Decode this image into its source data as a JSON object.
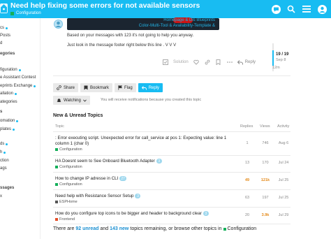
{
  "header": {
    "title": "Need help fixing some errors for not available sensors",
    "category": "Configuration",
    "category_color": "#14af5a",
    "accent": "#18bcf2",
    "icons": [
      "chat-icon",
      "search-icon",
      "hamburger-icon",
      "user-avatar-icon"
    ]
  },
  "sidebar": {
    "items": [
      {
        "label": "cs",
        "dot": true
      },
      {
        "label": "Posts",
        "dot": false
      },
      {
        "label": "d",
        "dot": false
      },
      {
        "label": "egories",
        "dot": false,
        "head": true
      },
      {
        "label": "figuration",
        "dot": true
      },
      {
        "label": "e Assistant Contest",
        "dot": false
      },
      {
        "label": "eprints Exchange",
        "dot": true
      },
      {
        "label": "allation",
        "dot": true
      },
      {
        "label": "ategories",
        "dot": false
      },
      {
        "label": "s",
        "dot": false,
        "head": true
      },
      {
        "label": "omation",
        "dot": true
      },
      {
        "label": "plates",
        "dot": true
      },
      {
        "label": "ds",
        "dot": true
      },
      {
        "label": "h",
        "dot": true
      },
      {
        "label": "ction",
        "dot": false
      },
      {
        "label": "ags",
        "dot": false
      },
      {
        "label": "ssages",
        "dot": false,
        "head": true
      },
      {
        "label": "x",
        "dot": false
      }
    ]
  },
  "post": {
    "banner_line1": "Homepage & Dis                 Blueprints",
    "banner_line2": "Color-Multi-Tool & Availability-Template &",
    "text1": "Based on your messages with 123 it's not going to help you anyway.",
    "text2": "Just look in the message footer right below this line . V V V",
    "actions": {
      "solution": "Solution",
      "reply": "Reply"
    }
  },
  "timeline": {
    "count": "19 / 19",
    "date": "Sep 8",
    "ago": "12m"
  },
  "footer": {
    "share": "Share",
    "bookmark": "Bookmark",
    "flag": "Flag",
    "reply": "Reply",
    "watching": "Watching",
    "notify_text": "You will receive notifications because you created this topic"
  },
  "suggested": {
    "title": "New & Unread Topics",
    "headers": {
      "topic": "Topic",
      "replies": "Replies",
      "views": "Views",
      "activity": "Activity"
    },
    "rows": [
      {
        "title": ": Error executing script. Unexpected error for call_service at pos 1: Expecting value: line 1",
        "title2": "column 1 (char 0)",
        "badge": "",
        "category": "Configuration",
        "cat_color": "#14af5a",
        "replies": "1",
        "views": "746",
        "activity": "Aug 6",
        "hot": false
      },
      {
        "title": "HA Doesnt seem to See Onboard Bluetooth Adapter",
        "title2": "",
        "badge": "3",
        "category": "Configuration",
        "cat_color": "#14af5a",
        "replies": "13",
        "views": "170",
        "activity": "Jul 24",
        "hot": false
      },
      {
        "title": "How to change IP adresse in CLI",
        "title2": "",
        "badge": "27",
        "category": "Configuration",
        "cat_color": "#14af5a",
        "replies": "49",
        "views": "121k",
        "activity": "Jul 25",
        "hot": true
      },
      {
        "title": "Need help with Resistance Sensor Setup",
        "title2": "",
        "badge": "3",
        "category": "ESPHome",
        "cat_color": "#555555",
        "replies": "63",
        "views": "197",
        "activity": "Jul 25",
        "hot": false
      },
      {
        "title": "How do you configure top icons to be bigger and header to background clear",
        "title2": "",
        "badge": "3",
        "category": "Frontend",
        "cat_color": "#e44d26",
        "replies": "20",
        "views": "3.9k",
        "activity": "Jul 29",
        "hot": false
      }
    ],
    "more": {
      "pre": "There are",
      "unread": "92 unread",
      "and": "and",
      "new": "143 new",
      "post": "topics remaining, or browse other topics in",
      "category": "Configuration"
    }
  }
}
